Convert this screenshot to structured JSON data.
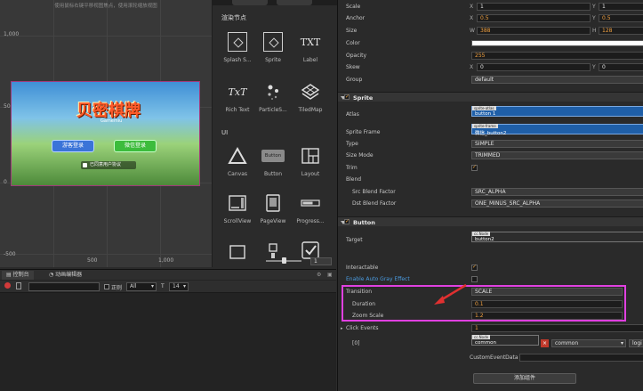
{
  "scene": {
    "hint": "使用鼠标右键平移视图焦点，使用滚轮缩放视图",
    "axis_labels": [
      "1,000",
      "500",
      "0",
      "-500",
      "500",
      "1,000"
    ],
    "game": {
      "logo": "贝密棋牌",
      "logo_sub": "Gamemiu",
      "btn_guest": "游客登录",
      "btn_wechat": "微信登录",
      "agree": "已同意用户协议"
    }
  },
  "node_library": {
    "section_render": "渲染节点",
    "section_ui": "UI",
    "render_items": [
      {
        "label": "Splash S..."
      },
      {
        "label": "Sprite"
      },
      {
        "label": "Label",
        "glyph": "TXT"
      },
      {
        "label": "Rich Text",
        "glyph": "TxT"
      },
      {
        "label": "ParticleS..."
      },
      {
        "label": "TiledMap"
      }
    ],
    "ui_items": [
      {
        "label": "Canvas"
      },
      {
        "label": "Button",
        "glyph": "Button"
      },
      {
        "label": "Layout"
      },
      {
        "label": "ScrollView"
      },
      {
        "label": "PageView"
      },
      {
        "label": "Progress..."
      }
    ],
    "zoom_value": "1"
  },
  "console": {
    "tabs": [
      "控制台",
      "动画编辑器"
    ],
    "regex_label": "正则",
    "level": "All",
    "font_size": "14"
  },
  "inspector": {
    "node": {
      "scale": {
        "label": "Scale",
        "x": "1",
        "y": "1"
      },
      "anchor": {
        "label": "Anchor",
        "x": "0.5",
        "y": "0.5"
      },
      "size": {
        "label": "Size",
        "w": "388",
        "h": "128"
      },
      "color": {
        "label": "Color",
        "value": "#ffffff"
      },
      "opacity": {
        "label": "Opacity",
        "value": "255"
      },
      "skew": {
        "label": "Skew",
        "x": "0",
        "y": "0"
      },
      "group": {
        "label": "Group",
        "value": "default"
      }
    },
    "sprite": {
      "header": "Sprite",
      "atlas": {
        "label": "Atlas",
        "tag": "sprite-atlas",
        "value": "button 1"
      },
      "frame": {
        "label": "Sprite Frame",
        "tag": "sprite-frame",
        "value": "微信_button2"
      },
      "type": {
        "label": "Type",
        "value": "SIMPLE"
      },
      "size_mode": {
        "label": "Size Mode",
        "value": "TRIMMED"
      },
      "trim": {
        "label": "Trim"
      },
      "blend": {
        "label": "Blend"
      },
      "src": {
        "label": "Src Blend Factor",
        "value": "SRC_ALPHA"
      },
      "dst": {
        "label": "Dst Blend Factor",
        "value": "ONE_MINUS_SRC_ALPHA"
      }
    },
    "button": {
      "header": "Button",
      "target": {
        "label": "Target",
        "tag": "cc.Node",
        "value": "button2"
      },
      "interactable": {
        "label": "Interactable"
      },
      "auto_gray": {
        "label": "Enable Auto Gray Effect"
      },
      "transition": {
        "label": "Transition",
        "value": "SCALE"
      },
      "duration": {
        "label": "Duration",
        "value": "0.1"
      },
      "zoom": {
        "label": "Zoom Scale",
        "value": "1.2"
      },
      "click_events": {
        "label": "Click Events",
        "value": "1"
      },
      "event0": {
        "index": "[0]",
        "tag": "cc.Node",
        "node": "common",
        "component": "common",
        "handler": "logi"
      },
      "custom": {
        "label": "CustomEventData",
        "value": ""
      }
    },
    "add_component": "添加组件",
    "accent": "#e040e0"
  }
}
